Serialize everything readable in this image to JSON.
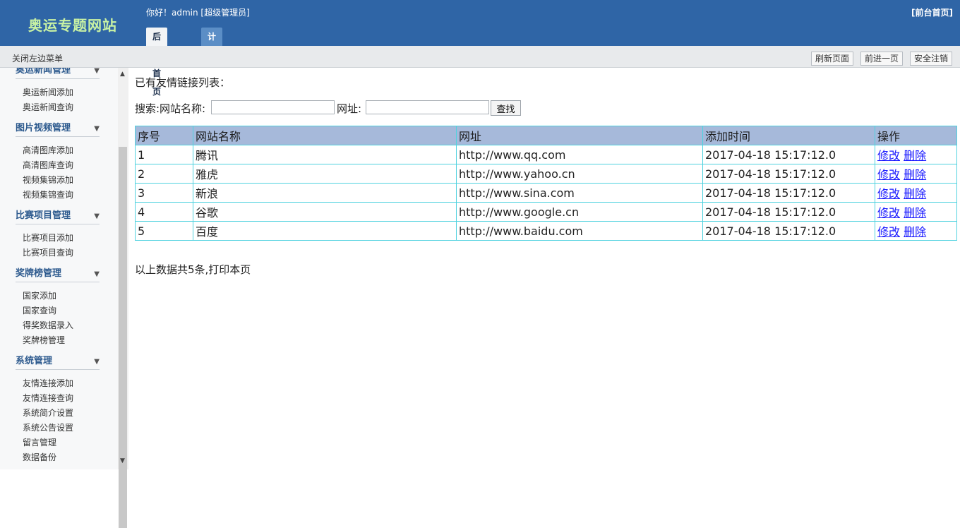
{
  "header": {
    "logo": "奥运专题网站",
    "greeting": "你好！admin [超级管理员]",
    "front_link": "[前台首页]",
    "tabs": [
      {
        "label": "后台首页",
        "active": true
      },
      {
        "label": "计算器",
        "active": false
      }
    ],
    "colors": {
      "bar": "#2f65a6",
      "logo": "#c8f2a4"
    }
  },
  "toolbar": {
    "toggle_menu": "关闭左边菜单",
    "refresh": "刷新页面",
    "forward": "前进一页",
    "logout": "安全注销"
  },
  "sidebar": {
    "groups": [
      {
        "title": "奥运新闻管理",
        "items": [
          "奥运新闻添加",
          "奥运新闻查询"
        ]
      },
      {
        "title": "图片视频管理",
        "items": [
          "高清图库添加",
          "高清图库查询",
          "视频集锦添加",
          "视频集锦查询"
        ]
      },
      {
        "title": "比赛项目管理",
        "items": [
          "比赛项目添加",
          "比赛项目查询"
        ]
      },
      {
        "title": "奖牌榜管理",
        "items": [
          "国家添加",
          "国家查询",
          "得奖数据录入",
          "奖牌榜管理"
        ]
      },
      {
        "title": "系统管理",
        "items": [
          "友情连接添加",
          "友情连接查询",
          "系统简介设置",
          "系统公告设置",
          "留言管理",
          "数据备份"
        ]
      }
    ]
  },
  "main": {
    "list_title": "已有友情链接列表：",
    "search": {
      "name_label": "搜索:网站名称:",
      "name_value": "",
      "url_label": "网址:",
      "url_value": "",
      "button": "查找"
    },
    "table": {
      "headers": [
        "序号",
        "网站名称",
        "网址",
        "添加时间",
        "操作"
      ],
      "edit_label": "修改",
      "delete_label": "删除",
      "rows": [
        {
          "id": "1",
          "name": "腾讯",
          "url": "http://www.qq.com",
          "time": "2017-04-18 15:17:12.0"
        },
        {
          "id": "2",
          "name": "雅虎",
          "url": "http://www.yahoo.cn",
          "time": "2017-04-18 15:17:12.0"
        },
        {
          "id": "3",
          "name": "新浪",
          "url": "http://www.sina.com",
          "time": "2017-04-18 15:17:12.0"
        },
        {
          "id": "4",
          "name": "谷歌",
          "url": "http://www.google.cn",
          "time": "2017-04-18 15:17:12.0"
        },
        {
          "id": "5",
          "name": "百度",
          "url": "http://www.baidu.com",
          "time": "2017-04-18 15:17:12.0"
        }
      ]
    },
    "summary": "以上数据共5条,打印本页"
  }
}
